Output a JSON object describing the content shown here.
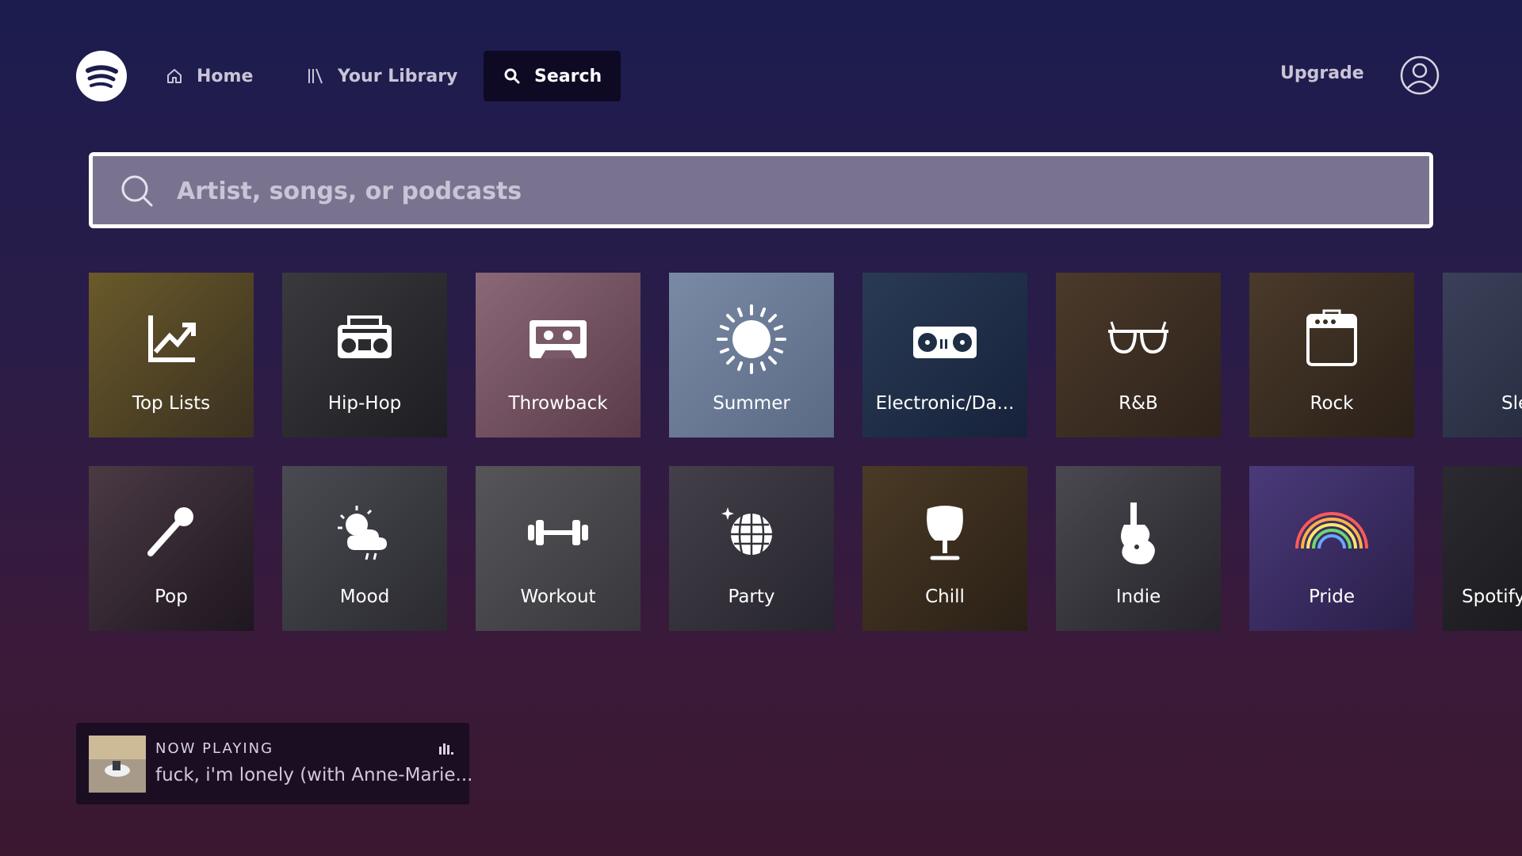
{
  "nav": {
    "logo_icon": "spotify-logo-icon",
    "home_label": "Home",
    "library_label": "Your Library",
    "search_label": "Search",
    "upgrade_label": "Upgrade",
    "avatar_icon": "user-avatar-icon"
  },
  "search": {
    "placeholder": "Artist, songs, or podcasts",
    "value": ""
  },
  "categories_row1": [
    {
      "label": "Top Lists",
      "icon": "trending-chart-icon",
      "bg": "#5a4a22"
    },
    {
      "label": "Hip-Hop",
      "icon": "boombox-icon",
      "bg": "#2b2b2f"
    },
    {
      "label": "Throwback",
      "icon": "cassette-icon",
      "bg": "#7a5a68"
    },
    {
      "label": "Summer",
      "icon": "sun-icon",
      "bg": "#6a7a95"
    },
    {
      "label": "Electronic/Da...",
      "icon": "turntable-icon",
      "bg": "#1e2e44"
    },
    {
      "label": "R&B",
      "icon": "sunglasses-icon",
      "bg": "#3e3024"
    },
    {
      "label": "Rock",
      "icon": "amplifier-icon",
      "bg": "#3a2e22"
    },
    {
      "label": "Sle",
      "icon": "bed-icon",
      "bg": "#2e3448"
    }
  ],
  "categories_row2": [
    {
      "label": "Pop",
      "icon": "microphone-icon",
      "bg": "#2e2430"
    },
    {
      "label": "Mood",
      "icon": "weather-mood-icon",
      "bg": "#3a3a40"
    },
    {
      "label": "Workout",
      "icon": "dumbbell-icon",
      "bg": "#46464a"
    },
    {
      "label": "Party",
      "icon": "disco-ball-icon",
      "bg": "#34323a"
    },
    {
      "label": "Chill",
      "icon": "egg-chair-icon",
      "bg": "#3a2e20"
    },
    {
      "label": "Indie",
      "icon": "electric-guitar-icon",
      "bg": "#36343a"
    },
    {
      "label": "Pride",
      "icon": "rainbow-icon",
      "bg": "#3c2c5e"
    },
    {
      "label": "Spotify",
      "icon": "mixer-icon",
      "bg": "#1e1e24"
    }
  ],
  "now_playing": {
    "label": "NOW PLAYING",
    "title": "fuck, i'm lonely (with Anne-Marie...",
    "status_icon": "equalizer-icon"
  }
}
